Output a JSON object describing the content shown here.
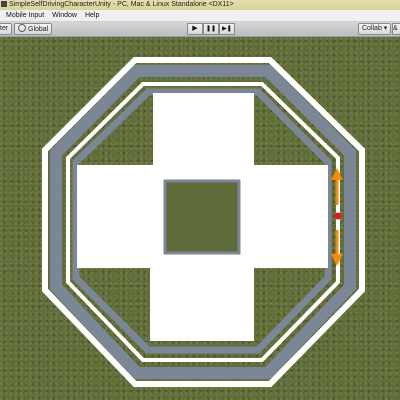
{
  "window": {
    "title": "SimpleSelfDrivingCharacterUnity - PC, Mac & Linux Standalone <DX11>"
  },
  "menubar": {
    "items": [
      "Mobile Input",
      "Window",
      "Help"
    ]
  },
  "toolbar": {
    "pivot_label": "ter",
    "global_label": "Global",
    "play_icon": "▶",
    "pause_icon": "❚❚",
    "step_icon": "▶❚",
    "collab_label": "Collab ▾",
    "account_label": "&"
  },
  "scene": {
    "ground_color": "#5f6b3b",
    "road_color": "#7b8796",
    "barrier_color": "#ffffff",
    "platform_color": "#ffffff",
    "arrow_color": "#f28c0f",
    "agent_color": "#e01a1a"
  }
}
